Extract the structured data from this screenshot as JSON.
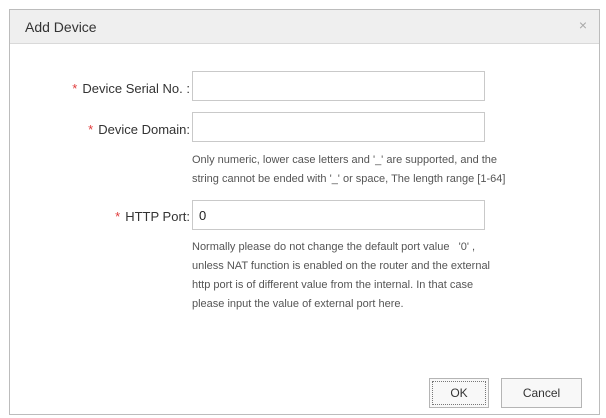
{
  "dialog": {
    "title": "Add Device",
    "close_glyph": "×"
  },
  "form": {
    "required_marker": "*",
    "serial": {
      "label": "Device Serial No. :",
      "value": "",
      "placeholder": ""
    },
    "domain": {
      "label": "Device Domain:",
      "value": "",
      "placeholder": "",
      "hint_lines": [
        "Only numeric, lower case letters and '_' are supported, and the",
        "string cannot be ended with '_' or space, The length range [1-64]"
      ]
    },
    "http_port": {
      "label": "HTTP Port:",
      "value": "0",
      "placeholder": "",
      "hint_lines": [
        "Normally please do not change the default port value   '0' ,",
        "unless NAT function is enabled on the router and the external",
        "http port is of different value from the internal. In that case",
        "please input the value of external port here."
      ]
    }
  },
  "buttons": {
    "ok_label": "OK",
    "cancel_label": "Cancel"
  }
}
